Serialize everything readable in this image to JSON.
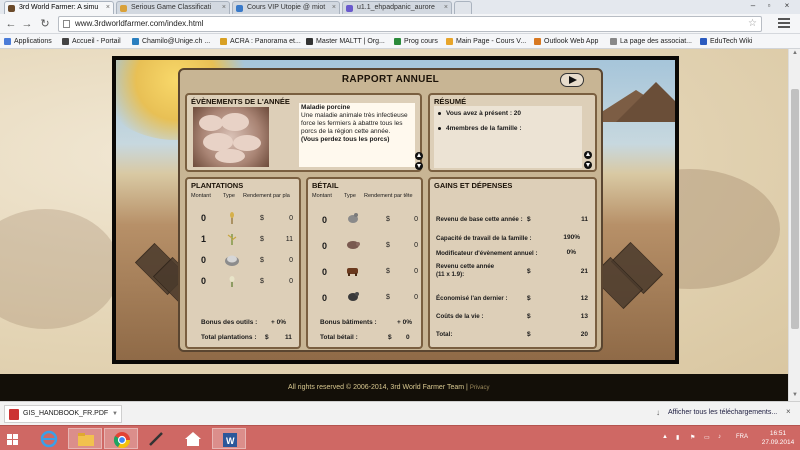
{
  "browser": {
    "tabs": [
      {
        "label": "3rd World Farmer: A simu",
        "color": "#6b4a2a"
      },
      {
        "label": "Serious Game Classificati",
        "color": "#d9a13a"
      },
      {
        "label": "Cours VIP Utopie @ miot",
        "color": "#3a7ac9"
      },
      {
        "label": "u1.1_ehpadpanic_aurore",
        "color": "#6a5acd"
      }
    ],
    "url": "www.3rdworldfarmer.com/index.html",
    "bookmarks": [
      {
        "label": "Applications",
        "color": "#4a7bd8"
      },
      {
        "label": "Accueil - Portail",
        "color": "#444"
      },
      {
        "label": "Chamilo@Unige.ch ...",
        "color": "#2a7fbf"
      },
      {
        "label": "ACRA : Panorama et...",
        "color": "#d8a024"
      },
      {
        "label": "Master MALTT | Org...",
        "color": "#333"
      },
      {
        "label": "Prog cours",
        "color": "#2a8a3a"
      },
      {
        "label": "Main Page - Cours V...",
        "color": "#e8a52a"
      },
      {
        "label": "Outlook Web App",
        "color": "#d87820"
      },
      {
        "label": "La page des associat...",
        "color": "#888"
      },
      {
        "label": "EduTech Wiki",
        "color": "#2a5abf"
      }
    ]
  },
  "report": {
    "title": "RAPPORT ANNUEL",
    "events": {
      "title": "ÉVÈNEMENTS DE L'ANNÉE",
      "event_name": "Maladie porcine",
      "event_desc": "Une maladie animale très infectieuse force les fermiers à abattre tous les porcs de la région cette année.",
      "event_warning": "(Vous perdez tous les porcs)"
    },
    "summary": {
      "title": "RÉSUMÉ",
      "line1": "Vous avez à présent :  20",
      "line2": "4membres de la famille :"
    },
    "plantations": {
      "title": "PLANTATIONS",
      "headers": {
        "amount": "Montant",
        "type": "Type",
        "yield": "Rendement par pla"
      },
      "rows": [
        {
          "amount": "0",
          "currency": "$",
          "value": "0",
          "icon": "wheat-icon"
        },
        {
          "amount": "1",
          "currency": "$",
          "value": "11",
          "icon": "corn-icon"
        },
        {
          "amount": "0",
          "currency": "$",
          "value": "0",
          "icon": "cotton-icon"
        },
        {
          "amount": "0",
          "currency": "$",
          "value": "0",
          "icon": "sprout-icon"
        }
      ],
      "tool_bonus_label": "Bonus des outils :",
      "tool_bonus_value": "+ 0%",
      "total_label": "Total plantations :",
      "total_currency": "$",
      "total_value": "11"
    },
    "livestock": {
      "title": "BÉTAIL",
      "headers": {
        "amount": "Montant",
        "type": "Type",
        "yield": "Rendement par tête"
      },
      "rows": [
        {
          "amount": "0",
          "currency": "$",
          "value": "0",
          "icon": "chicken-icon"
        },
        {
          "amount": "0",
          "currency": "$",
          "value": "0",
          "icon": "pig-icon"
        },
        {
          "amount": "0",
          "currency": "$",
          "value": "0",
          "icon": "cow-icon"
        },
        {
          "amount": "0",
          "currency": "$",
          "value": "0",
          "icon": "goat-icon"
        }
      ],
      "building_bonus_label": "Bonus bâtiments :",
      "building_bonus_value": "+ 0%",
      "total_label": "Total bétail :",
      "total_currency": "$",
      "total_value": "0"
    },
    "gains": {
      "title": "GAINS ET DÉPENSES",
      "rows": [
        {
          "label": "Revenu de base cette année :",
          "currency": "$",
          "value": "11"
        },
        {
          "label": "Capacité de travail de la famille :",
          "currency": "",
          "value": "190%"
        },
        {
          "label": "Modificateur d'évènement annuel :",
          "currency": "",
          "value": "0%"
        },
        {
          "label": "Revenu cette année\n(11 x 1.9):",
          "currency": "$",
          "value": "21"
        },
        {
          "label": "Économisé l'an dernier :",
          "currency": "$",
          "value": "12"
        },
        {
          "label": "Coûts de la vie :",
          "currency": "$",
          "value": "13"
        },
        {
          "label": "Total:",
          "currency": "$",
          "value": "20"
        }
      ]
    }
  },
  "footer": {
    "copyright": "All rights reserved © 2006-2014, 3rd World Farmer Team |",
    "privacy": "Privacy"
  },
  "downloads": {
    "file": "GIS_HANDBOOK_FR.PDF",
    "show_all": "Afficher tous les téléchargements..."
  },
  "taskbar": {
    "lang": "FRA",
    "time": "16:51",
    "date": "27.09.2014"
  }
}
